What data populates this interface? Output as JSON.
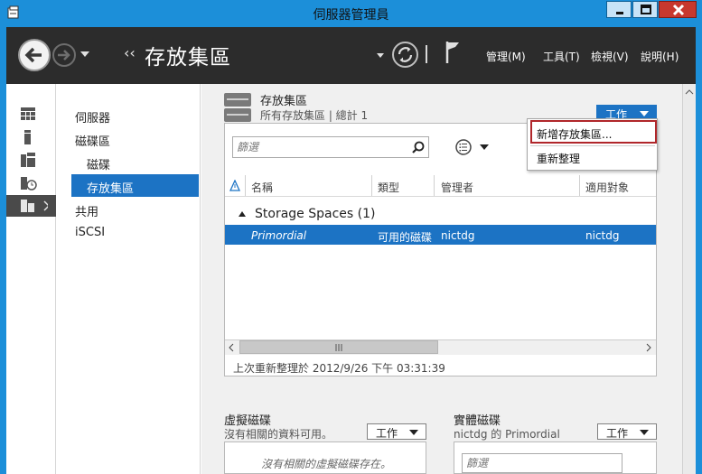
{
  "window": {
    "title": "伺服器管理員"
  },
  "header": {
    "breadcrumb_arrows": "‹‹",
    "page_title": "存放集區",
    "menus": [
      "管理(M)",
      "工具(T)",
      "檢視(V)",
      "說明(H)"
    ]
  },
  "nav": {
    "items": [
      "伺服器",
      "磁碟區",
      "磁碟",
      "存放集區",
      "共用",
      "iSCSI"
    ],
    "selected": "存放集區"
  },
  "pools_section": {
    "title": "存放集區",
    "subtitle": "所有存放集區 | 總計 1",
    "task_button": "工作",
    "filter_placeholder": "篩選",
    "columns": [
      "名稱",
      "類型",
      "管理者",
      "適用對象"
    ],
    "group_label": "Storage Spaces (1)",
    "rows": [
      {
        "name": "Primordial",
        "type": "可用的磁碟",
        "managed_by": "nictdg",
        "available_to": "nictdg"
      }
    ],
    "status_text": "上次重新整理於 2012/9/26 下午 03:31:39"
  },
  "task_menu": {
    "items": [
      "新增存放集區...",
      "重新整理"
    ],
    "highlighted_index": 0
  },
  "virtual_disks": {
    "title": "虛擬磁碟",
    "subtitle": "沒有相關的資料可用。",
    "task_button": "工作",
    "empty_text": "沒有相關的虛擬磁碟存在。"
  },
  "physical_disks": {
    "title": "實體磁碟",
    "subtitle": "nictdg 的 Primordial",
    "task_button": "工作",
    "filter_placeholder": "篩選"
  },
  "colors": {
    "titlebar": "#1c8fd9",
    "header": "#2c2c2c",
    "selection": "#1c73c4",
    "highlight_border": "#b0262a"
  }
}
